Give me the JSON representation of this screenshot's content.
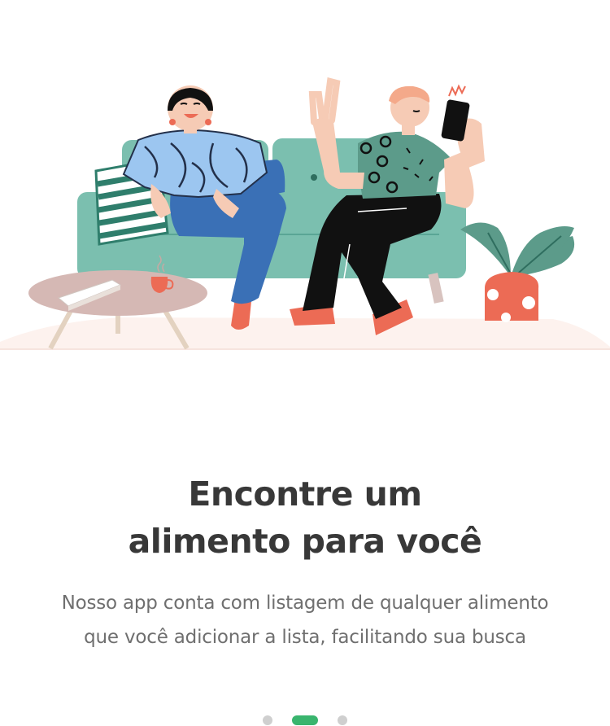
{
  "onboarding": {
    "title_line1": "Encontre um",
    "title_line2": "alimento para você",
    "description_line1": "Nosso app conta com listagem de qualquer alimento",
    "description_line2": "que você adicionar a lista, facilitando sua busca",
    "illustration": "two-people-on-couch-illustration",
    "pager": {
      "total_pages": 3,
      "active_page": 2
    }
  },
  "colors": {
    "accent": "#39b56e",
    "inactive_dot": "#cfcfcf",
    "title": "#383838",
    "text": "#6f6f6f",
    "sofa": "#7bbfaf",
    "floor": "#fdf2ee",
    "table": "#d5b8b4",
    "coral": "#ec6b55",
    "denim": "#3a70b6"
  }
}
